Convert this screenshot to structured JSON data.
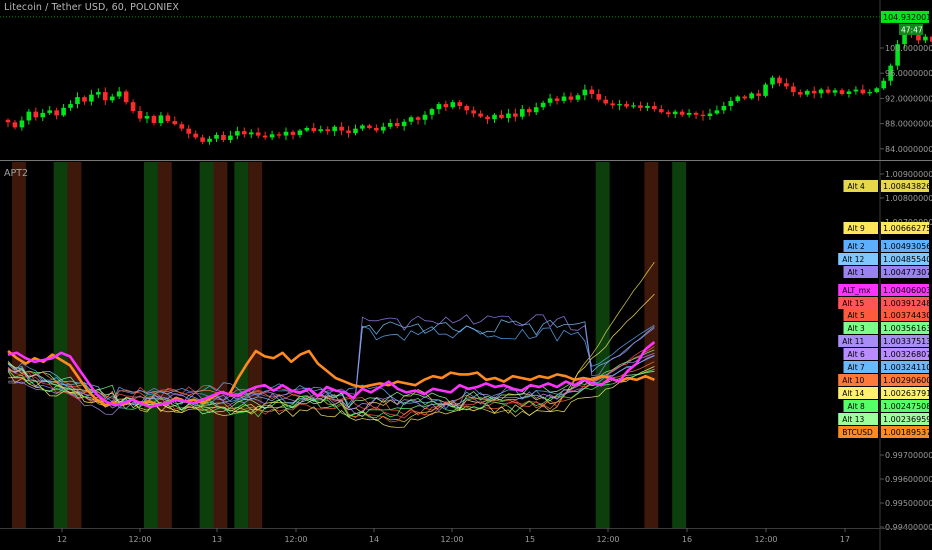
{
  "title": "Litecoin / Tether USD, 60, POLONIEX",
  "indicator": "APT2",
  "colors": {
    "background": "#000000",
    "up": "#00e61a",
    "down": "#ff2a2a",
    "price_tag": "#00e61a",
    "btc": "#ff8a1f",
    "alt_mx": "#e636e6"
  },
  "chart_data": [
    {
      "type": "candlestick",
      "title": "Litecoin / Tether USD, 60, POLONIEX",
      "y_ticks": [
        "100.00000000",
        "96.00000000",
        "92.00000000",
        "88.00000000",
        "84.00000000"
      ],
      "ylim": [
        82.5,
        107.5
      ],
      "last_price": "104.93200104",
      "countdown": "47:47",
      "closes": [
        88.2,
        87.4,
        88.5,
        89.9,
        89.0,
        89.7,
        90.1,
        89.3,
        90.5,
        91.1,
        92.2,
        91.5,
        92.6,
        93.0,
        91.7,
        92.3,
        93.1,
        91.4,
        90.0,
        88.8,
        89.2,
        88.1,
        89.3,
        88.4,
        87.9,
        87.2,
        86.4,
        85.8,
        85.1,
        85.6,
        86.2,
        85.4,
        86.1,
        86.8,
        86.3,
        86.6,
        86.1,
        85.8,
        86.3,
        86.1,
        86.7,
        86.2,
        86.9,
        87.3,
        86.8,
        87.1,
        86.8,
        87.5,
        86.9,
        86.5,
        87.2,
        87.7,
        87.3,
        86.9,
        87.5,
        88.1,
        87.6,
        88.3,
        89.0,
        88.6,
        89.4,
        90.3,
        91.1,
        90.6,
        91.4,
        90.8,
        90.1,
        89.6,
        89.1,
        88.7,
        89.4,
        88.9,
        89.6,
        89.1,
        90.3,
        89.8,
        90.6,
        91.3,
        92.0,
        91.6,
        92.3,
        91.8,
        92.5,
        93.4,
        92.7,
        91.8,
        91.2,
        90.9,
        91.1,
        90.7,
        90.9,
        90.5,
        90.8,
        90.3,
        89.8,
        89.5,
        89.9,
        89.4,
        89.7,
        89.4,
        89.2,
        89.6,
        90.1,
        90.8,
        91.6,
        92.3,
        92.0,
        92.8,
        92.4,
        94.2,
        95.3,
        94.4,
        93.9,
        93.0,
        92.6,
        93.2,
        92.8,
        93.4,
        92.9,
        93.3,
        92.7,
        93.1,
        93.4,
        92.8,
        93.0,
        93.6,
        94.8,
        97.2,
        100.6,
        102.8,
        102.3,
        101.2,
        101.8,
        101.0,
        101.6,
        102.1,
        102.6,
        103.5,
        104.93
      ],
      "x_ticks": [
        "12",
        "12:00",
        "13",
        "12:00",
        "14",
        "12:00",
        "15",
        "12:00",
        "16",
        "12:00",
        "17"
      ]
    },
    {
      "type": "line",
      "title": "APT2",
      "y_ticks": [
        "1.00900000",
        "1.00800000",
        "1.00700000",
        "0.99700000",
        "0.99600000",
        "0.99500000",
        "0.99400000"
      ],
      "series": [
        {
          "name": "Alt 4",
          "value": "1.00843826",
          "color": "#e6d84a"
        },
        {
          "name": "Alt 9",
          "value": "1.00666275",
          "color": "#ffe75c"
        },
        {
          "name": "Alt 2",
          "value": "1.00493056",
          "color": "#5cb0ff"
        },
        {
          "name": "Alt 12",
          "value": "1.00485540",
          "color": "#7ec8ff"
        },
        {
          "name": "Alt 1",
          "value": "1.00477307",
          "color": "#9a82f0"
        },
        {
          "name": "ALT_mx",
          "value": "1.00406003",
          "color": "#ff33ff"
        },
        {
          "name": "Alt 15",
          "value": "1.00391248",
          "color": "#ff5555"
        },
        {
          "name": "Alt 5",
          "value": "1.00374430",
          "color": "#ff5a3c"
        },
        {
          "name": "Alt 3",
          "value": "1.00356163",
          "color": "#7aff8a"
        },
        {
          "name": "Alt 11",
          "value": "1.00337513",
          "color": "#a98df7"
        },
        {
          "name": "Alt 6",
          "value": "1.00326807",
          "color": "#b98cff"
        },
        {
          "name": "Alt 7",
          "value": "1.00324110",
          "color": "#6ab9ff"
        },
        {
          "name": "Alt 10",
          "value": "1.00290600",
          "color": "#ff7a3a"
        },
        {
          "name": "Alt 14",
          "value": "1.00263791",
          "color": "#fff070"
        },
        {
          "name": "Alt 8",
          "value": "1.00247508",
          "color": "#55ff66"
        },
        {
          "name": "Alt 13",
          "value": "1.00236959",
          "color": "#9cff9c"
        },
        {
          "name": "BTCUSD",
          "value": "1.00189537",
          "color": "#ff8a1f"
        }
      ],
      "btc_levels": [
        1.0035,
        1.0031,
        1.0028,
        1.0031,
        1.0029,
        1.0033,
        1.003,
        1.0027,
        1.002,
        1.0013,
        1.0008,
        1.0005,
        1.0006,
        1.0005,
        1.0008,
        1.0006,
        1.0007,
        1.0005,
        1.0006,
        1.0009,
        1.0007,
        1.0008,
        1.0006,
        1.0009,
        1.0012,
        1.0011,
        1.002,
        1.0028,
        1.0035,
        1.0032,
        1.0031,
        1.0034,
        1.0029,
        1.0033,
        1.0035,
        1.0028,
        1.0024,
        1.002,
        1.0018,
        1.0016,
        1.0015,
        1.0016,
        1.0017,
        1.0016,
        1.0018,
        1.0017,
        1.0016,
        1.0019,
        1.0021,
        1.002,
        1.0023,
        1.0022,
        1.0022,
        1.0023,
        1.0019,
        1.002,
        1.0018,
        1.0021,
        1.002,
        1.0019,
        1.0021,
        1.002,
        1.0022,
        1.0021,
        1.0019,
        1.002,
        1.0019,
        1.0021,
        1.002,
        1.0018,
        1.002,
        1.0019,
        1.0021,
        1.0019
      ],
      "mx_levels": [
        1.0033,
        1.0034,
        1.0031,
        1.0029,
        1.003,
        1.0031,
        1.0034,
        1.0032,
        1.0025,
        1.0018,
        1.0011,
        1.0007,
        1.0005,
        1.0006,
        1.0008,
        1.0006,
        1.0004,
        1.0005,
        1.0006,
        1.0008,
        1.0007,
        1.0006,
        1.0008,
        1.001,
        1.0012,
        1.0011,
        1.001,
        1.0013,
        1.0015,
        1.0016,
        1.0013,
        1.0016,
        1.0013,
        1.0012,
        1.0014,
        1.001,
        1.0015,
        1.0013,
        1.0012,
        1.0009,
        1.0014,
        1.0012,
        1.0015,
        1.0018,
        1.0014,
        1.0012,
        1.0013,
        1.0011,
        1.0014,
        1.0013,
        1.0012,
        1.0016,
        1.0014,
        1.0015,
        1.0017,
        1.0015,
        1.0016,
        1.0014,
        1.0013,
        1.0016,
        1.0015,
        1.0017,
        1.0015,
        1.0018,
        1.0016,
        1.0019,
        1.0017,
        1.0016,
        1.002,
        1.0018,
        1.0024,
        1.0028,
        1.0036,
        1.004
      ],
      "shade_bands": [
        {
          "type": "down",
          "from": 1,
          "to": 3
        },
        {
          "type": "up",
          "from": 7,
          "to": 9
        },
        {
          "type": "down",
          "from": 9,
          "to": 11
        },
        {
          "type": "up",
          "from": 20,
          "to": 22
        },
        {
          "type": "down",
          "from": 22,
          "to": 24
        },
        {
          "type": "up",
          "from": 28,
          "to": 30
        },
        {
          "type": "down",
          "from": 30,
          "to": 32
        },
        {
          "type": "up",
          "from": 33,
          "to": 35
        },
        {
          "type": "down",
          "from": 35,
          "to": 37
        },
        {
          "type": "up",
          "from": 85,
          "to": 87
        },
        {
          "type": "down",
          "from": 92,
          "to": 94
        },
        {
          "type": "up",
          "from": 96,
          "to": 98
        }
      ]
    }
  ]
}
